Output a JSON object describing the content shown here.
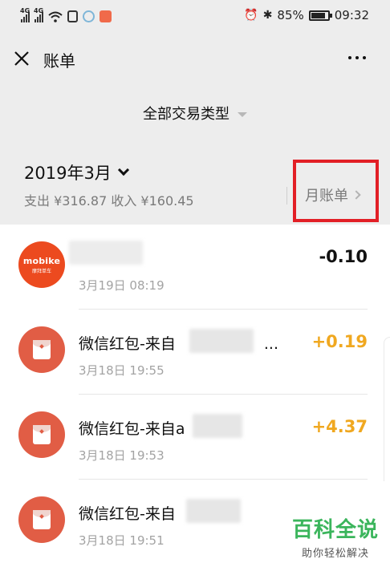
{
  "status_bar": {
    "signal1_net": "4G",
    "signal2_net": "4G",
    "battery_percent_text": "85%",
    "battery_level": 0.85,
    "time": "09:32"
  },
  "header": {
    "title": "账单",
    "close_icon": "close-icon",
    "more_icon": "more-icon"
  },
  "filter": {
    "label": "全部交易类型"
  },
  "month": {
    "title": "2019年3月",
    "summary": "支出 ¥316.87 收入 ¥160.45",
    "monthly_bill_label": "月账单"
  },
  "colors": {
    "background": "#ededed",
    "income_amount": "#f0a820",
    "highlight_box": "#e21f26",
    "red_packet": "#e15d45",
    "mobike": "#ec4a1f",
    "watermark": "#3bb55c"
  },
  "transactions": [
    {
      "name": "",
      "date": "3月19日 08:19",
      "amount": "-0.10",
      "type": "expense",
      "icon": "mobike-logo",
      "logo_text": "mobike",
      "logo_sub": "摩拜单车"
    },
    {
      "name": "微信红包-来自",
      "name_suffix": "...",
      "date": "3月18日 19:55",
      "amount": "+0.19",
      "type": "income",
      "icon": "red-packet-icon"
    },
    {
      "name": "微信红包-来自a",
      "date": "3月18日 19:53",
      "amount": "+4.37",
      "type": "income",
      "icon": "red-packet-icon"
    },
    {
      "name": "微信红包-来自",
      "date": "3月18日 19:51",
      "amount": "",
      "type": "income",
      "icon": "red-packet-icon"
    }
  ],
  "watermark": {
    "title": "百科全说",
    "subtitle": "助你轻松解决"
  }
}
